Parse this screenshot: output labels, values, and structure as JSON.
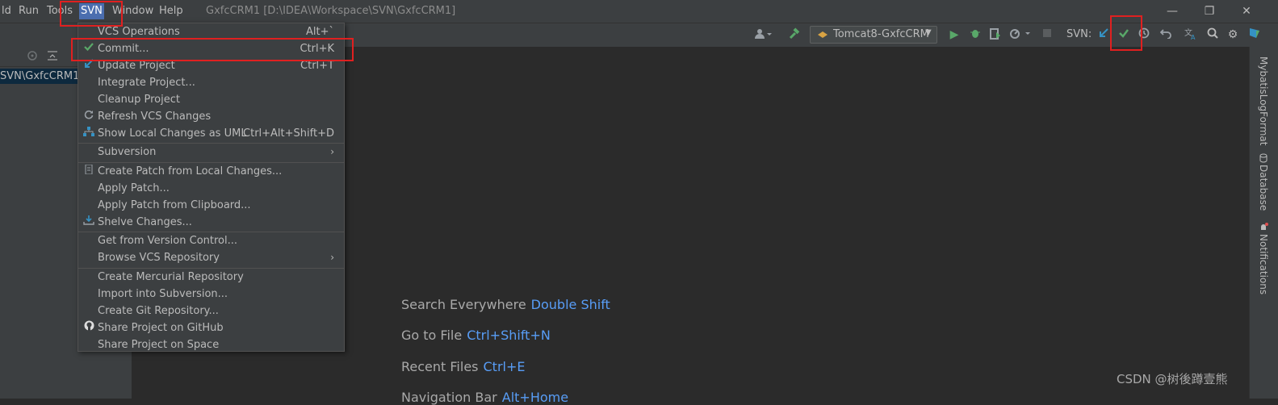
{
  "menubar": {
    "items": [
      "ld",
      "Run",
      "Tools",
      "SVN",
      "Window",
      "Help"
    ],
    "window_title": "GxfcCRM1 [D:\\IDEA\\Workspace\\SVN\\GxfcCRM1]",
    "controls": {
      "minimize": "—",
      "restore": "❐",
      "close": "✕"
    }
  },
  "toolbar": {
    "run_config": "Tomcat8-GxfcCRM",
    "svn_label": "SVN:"
  },
  "left_panel": {
    "project_node": "SVN\\GxfcCRM1"
  },
  "right_strip": {
    "tabs": [
      "MybatisLogFormat",
      "Database",
      "Notifications"
    ]
  },
  "svn_menu": {
    "items": [
      {
        "label": "VCS Operations",
        "shortcut": "Alt+`",
        "icon": ""
      },
      {
        "label": "Commit...",
        "shortcut": "Ctrl+K",
        "icon": "check-icon"
      },
      {
        "label": "Update Project",
        "shortcut": "Ctrl+T",
        "icon": "update-arrow-icon"
      },
      {
        "label": "Integrate Project...",
        "shortcut": "",
        "icon": ""
      },
      {
        "label": "Cleanup Project",
        "shortcut": "",
        "icon": ""
      },
      {
        "label": "Refresh VCS Changes",
        "shortcut": "",
        "icon": "refresh-icon"
      },
      {
        "label": "Show Local Changes as UML",
        "shortcut": "Ctrl+Alt+Shift+D",
        "icon": "uml-icon"
      },
      {
        "label": "Subversion",
        "shortcut": "",
        "icon": "",
        "submenu": true
      },
      {
        "label": "Create Patch from Local Changes...",
        "shortcut": "",
        "icon": "patch-icon"
      },
      {
        "label": "Apply Patch...",
        "shortcut": "",
        "icon": ""
      },
      {
        "label": "Apply Patch from Clipboard...",
        "shortcut": "",
        "icon": ""
      },
      {
        "label": "Shelve Changes...",
        "shortcut": "",
        "icon": "shelve-icon"
      },
      {
        "label": "Get from Version Control...",
        "shortcut": "",
        "icon": ""
      },
      {
        "label": "Browse VCS Repository",
        "shortcut": "",
        "icon": "",
        "submenu": true
      },
      {
        "label": "Create Mercurial Repository",
        "shortcut": "",
        "icon": ""
      },
      {
        "label": "Import into Subversion...",
        "shortcut": "",
        "icon": ""
      },
      {
        "label": "Create Git Repository...",
        "shortcut": "",
        "icon": ""
      },
      {
        "label": "Share Project on GitHub",
        "shortcut": "",
        "icon": "github-icon"
      },
      {
        "label": "Share Project on Space",
        "shortcut": "",
        "icon": ""
      }
    ]
  },
  "editor_hints": [
    {
      "label": "Search Everywhere",
      "key": "Double Shift"
    },
    {
      "label": "Go to File",
      "key": "Ctrl+Shift+N"
    },
    {
      "label": "Recent Files",
      "key": "Ctrl+E"
    },
    {
      "label": "Navigation Bar",
      "key": "Alt+Home"
    }
  ],
  "watermark": "CSDN @树後蹲壹熊",
  "colors": {
    "accent": "#4b6eaf",
    "highlight_box": "#e02020",
    "link": "#589df6",
    "check": "#59a869"
  }
}
